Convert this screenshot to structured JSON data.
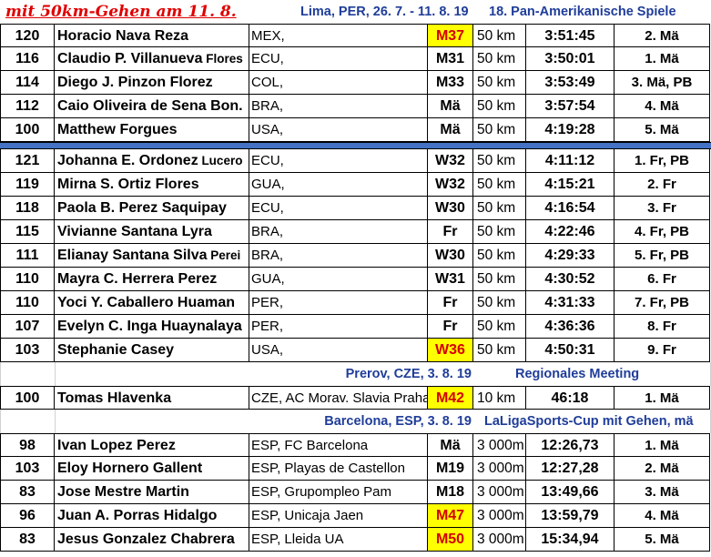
{
  "tag": "mit 50km-Gehen am 11. 8.",
  "colors": {
    "accent": "#1f3d99",
    "tag": "#e00000",
    "highlight": "#ffff00",
    "separator": "#4472c4"
  },
  "sections": [
    {
      "location": "Lima, PER,  26. 7. - 11. 8. 19",
      "event": "18. Pan-Amerikanische Spiele",
      "rows": [
        {
          "bib": "120",
          "name": "Horacio Nava Reza",
          "name_extra": "",
          "club": "MEX,",
          "cat": "M37",
          "hl": true,
          "dist": "50 km",
          "time": "3:51:45",
          "place": "2. Mä"
        },
        {
          "bib": "116",
          "name": "Claudio P. Villanueva",
          "name_extra": "Flores",
          "club": "ECU,",
          "cat": "M31",
          "hl": false,
          "dist": "50 km",
          "time": "3:50:01",
          "place": "1. Mä"
        },
        {
          "bib": "114",
          "name": "Diego J. Pinzon Florez",
          "name_extra": "",
          "club": "COL,",
          "cat": "M33",
          "hl": false,
          "dist": "50 km",
          "time": "3:53:49",
          "place": "3. Mä, PB"
        },
        {
          "bib": "112",
          "name": "Caio Oliveira de Sena Bon.",
          "name_extra": "",
          "club": "BRA,",
          "cat": "Mä",
          "hl": false,
          "dist": "50 km",
          "time": "3:57:54",
          "place": "4. Mä"
        },
        {
          "bib": "100",
          "name": "Matthew Forgues",
          "name_extra": "",
          "club": "USA,",
          "cat": "Mä",
          "hl": false,
          "dist": "50 km",
          "time": "4:19:28",
          "place": "5. Mä"
        }
      ]
    },
    {
      "location": "",
      "event": "",
      "separator": true,
      "rows": [
        {
          "bib": "121",
          "name": "Johanna E. Ordonez",
          "name_extra": "Lucero",
          "club": "ECU,",
          "cat": "W32",
          "hl": false,
          "dist": "50 km",
          "time": "4:11:12",
          "place": "1. Fr, PB"
        },
        {
          "bib": "119",
          "name": "Mirna S. Ortiz Flores",
          "name_extra": "",
          "club": "GUA,",
          "cat": "W32",
          "hl": false,
          "dist": "50 km",
          "time": "4:15:21",
          "place": "2. Fr"
        },
        {
          "bib": "118",
          "name": "Paola B. Perez Saquipay",
          "name_extra": "",
          "club": "ECU,",
          "cat": "W30",
          "hl": false,
          "dist": "50 km",
          "time": "4:16:54",
          "place": "3. Fr"
        },
        {
          "bib": "115",
          "name": "Vivianne Santana Lyra",
          "name_extra": "",
          "club": "BRA,",
          "cat": "Fr",
          "hl": false,
          "dist": "50 km",
          "time": "4:22:46",
          "place": "4. Fr, PB"
        },
        {
          "bib": "111",
          "name": "Elianay Santana Silva",
          "name_extra": "Perei",
          "club": "BRA,",
          "cat": "W30",
          "hl": false,
          "dist": "50 km",
          "time": "4:29:33",
          "place": "5. Fr, PB"
        },
        {
          "bib": "110",
          "name": "Mayra C. Herrera Perez",
          "name_extra": "",
          "club": "GUA,",
          "cat": "W31",
          "hl": false,
          "dist": "50 km",
          "time": "4:30:52",
          "place": "6. Fr"
        },
        {
          "bib": "110",
          "name": "Yoci Y. Caballero Huaman",
          "name_extra": "",
          "club": "PER,",
          "cat": "Fr",
          "hl": false,
          "dist": "50 km",
          "time": "4:31:33",
          "place": "7. Fr, PB"
        },
        {
          "bib": "107",
          "name": "Evelyn C. Inga Huaynalaya",
          "name_extra": "",
          "club": "PER,",
          "cat": "Fr",
          "hl": false,
          "dist": "50 km",
          "time": "4:36:36",
          "place": "8. Fr"
        },
        {
          "bib": "103",
          "name": "Stephanie Casey",
          "name_extra": "",
          "club": "USA,",
          "cat": "W36",
          "hl": true,
          "dist": "50 km",
          "time": "4:50:31",
          "place": "9. Fr"
        }
      ]
    },
    {
      "location": "Prerov, CZE,  3. 8. 19",
      "event": "Regionales Meeting",
      "rows": [
        {
          "bib": "100",
          "name": "Tomas Hlavenka",
          "name_extra": "",
          "club": "CZE, AC Morav. Slavia Praha",
          "cat": "M42",
          "hl": true,
          "dist": "10 km",
          "time": "46:18",
          "place": "1. Mä"
        }
      ]
    },
    {
      "location": "Barcelona, ESP,  3. 8. 19",
      "event": "LaLigaSports-Cup mit Gehen, mä",
      "rows": [
        {
          "bib": "98",
          "name": "Ivan Lopez Perez",
          "name_extra": "",
          "club": "ESP, FC Barcelona",
          "cat": "Mä",
          "hl": false,
          "dist": "3 000m",
          "time": "12:26,73",
          "place": "1. Mä"
        },
        {
          "bib": "103",
          "name": "Eloy Hornero Gallent",
          "name_extra": "",
          "club": "ESP, Playas de Castellon",
          "cat": "M19",
          "hl": false,
          "dist": "3 000m",
          "time": "12:27,28",
          "place": "2. Mä"
        },
        {
          "bib": "83",
          "name": "Jose Mestre Martin",
          "name_extra": "",
          "club": "ESP, Grupompleo Pam",
          "cat": "M18",
          "hl": false,
          "dist": "3 000m",
          "time": "13:49,66",
          "place": "3. Mä"
        },
        {
          "bib": "96",
          "name": "Juan A. Porras Hidalgo",
          "name_extra": "",
          "club": "ESP, Unicaja Jaen",
          "cat": "M47",
          "hl": true,
          "dist": "3 000m",
          "time": "13:59,79",
          "place": "4. Mä"
        },
        {
          "bib": "83",
          "name": "Jesus Gonzalez Chabrera",
          "name_extra": "",
          "club": "ESP, Lleida UA",
          "cat": "M50",
          "hl": true,
          "dist": "3 000m",
          "time": "15:34,94",
          "place": "5. Mä"
        }
      ]
    }
  ]
}
